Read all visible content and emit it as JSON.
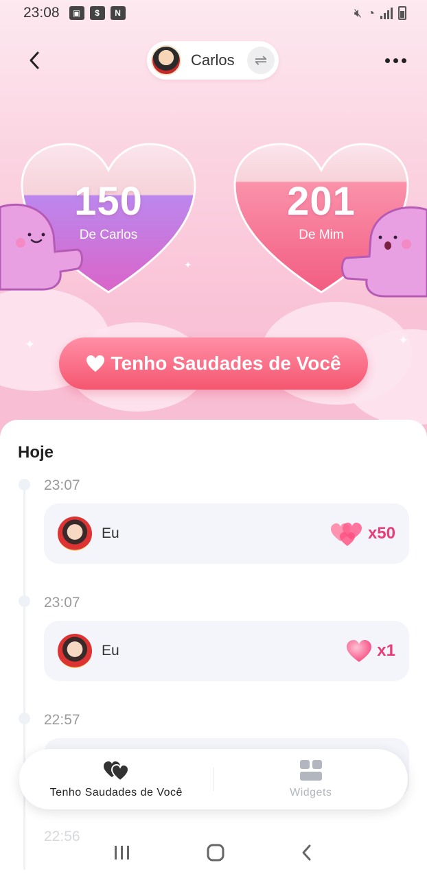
{
  "status_bar": {
    "time": "23:08"
  },
  "header": {
    "partner_name": "Carlos",
    "back_icon": "chevron-left-icon",
    "more_icon": "more-horizontal-icon",
    "swap_icon": "swap-icon"
  },
  "hearts": {
    "left": {
      "count": "150",
      "label": "De Carlos",
      "color": "#c56ee0"
    },
    "right": {
      "count": "201",
      "label": "De Mim",
      "color": "#f45b80"
    }
  },
  "miss_button": {
    "label": "Tenho Saudades de Você",
    "icon": "heart-icon"
  },
  "timeline": {
    "section_title": "Hoje",
    "entries": [
      {
        "time": "23:07",
        "name": "Eu",
        "count": "x50",
        "icon": "hearts-cluster-icon"
      },
      {
        "time": "23:07",
        "name": "Eu",
        "count": "x1",
        "icon": "heart-icon"
      },
      {
        "time": "22:57"
      },
      {
        "time": "22:56"
      }
    ]
  },
  "bottom_nav": {
    "items": [
      {
        "label": "Tenho Saudades de Você",
        "icon": "double-heart-icon",
        "active": true
      },
      {
        "label": "Widgets",
        "icon": "widgets-grid-icon",
        "active": false
      }
    ]
  },
  "colors": {
    "accent": "#e83d78",
    "button": "#f5566f"
  }
}
